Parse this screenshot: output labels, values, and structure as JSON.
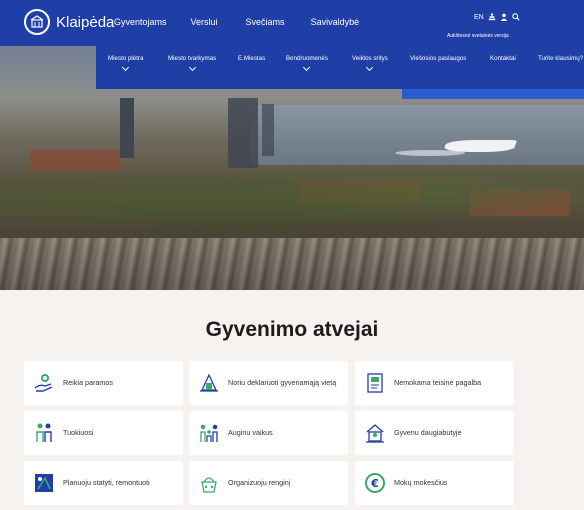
{
  "brand": {
    "name": "Klaipėda"
  },
  "main_nav": [
    "Gyventojams",
    "Verslui",
    "Svečiams",
    "Savivaldybė"
  ],
  "utility": {
    "language": "EN",
    "contrast_label": "Aukštesnė svetainės versija"
  },
  "sub_nav": [
    {
      "label": "Miesto plėtra",
      "has_dropdown": true
    },
    {
      "label": "Miesto tvarkymas",
      "has_dropdown": true
    },
    {
      "label": "E.Miestas",
      "has_dropdown": false
    },
    {
      "label": "Bendruomenės",
      "has_dropdown": true
    },
    {
      "label": "Veiklos sritys",
      "has_dropdown": true
    },
    {
      "label": "Viešosios paslaugos",
      "has_dropdown": false
    },
    {
      "label": "Kontaktai",
      "has_dropdown": false
    },
    {
      "label": "Turite klausimų?",
      "has_dropdown": false
    }
  ],
  "section": {
    "title": "Gyvenimo atvejai",
    "cards": [
      {
        "label": "Reikia paramos",
        "icon": "support-hand-icon"
      },
      {
        "label": "Noriu deklaruoti gyvenamąją vietą",
        "icon": "residence-declaration-icon"
      },
      {
        "label": "Nemokama teisinė pagalba",
        "icon": "legal-document-icon"
      },
      {
        "label": "Tuokiuosi",
        "icon": "couple-icon"
      },
      {
        "label": "Auginu vaikus",
        "icon": "family-icon"
      },
      {
        "label": "Gyvenu daugiabutyje",
        "icon": "apartment-house-icon"
      },
      {
        "label": "Planuoju statyti, remontuoti",
        "icon": "construction-plan-icon"
      },
      {
        "label": "Organizuoju renginį",
        "icon": "event-icon"
      },
      {
        "label": "Mokų mokesčius",
        "icon": "euro-coin-icon"
      }
    ]
  },
  "colors": {
    "primary": "#1f3fa6",
    "accent": "#2d5bd1",
    "icon_green": "#2e8b57",
    "icon_blue": "#1f3fa6",
    "background": "#f5f2ef"
  }
}
